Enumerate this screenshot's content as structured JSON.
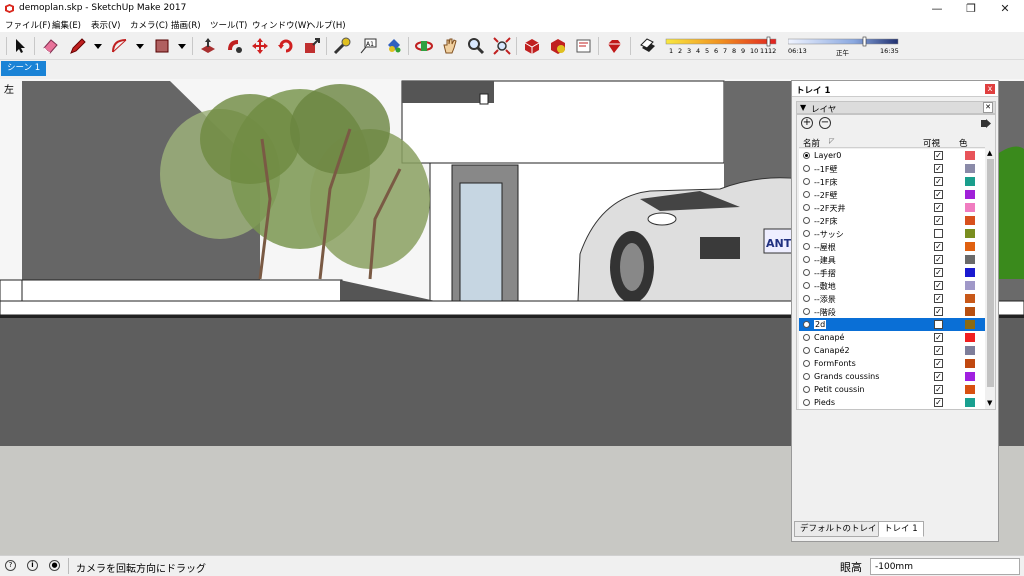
{
  "window": {
    "title": "demoplan.skp - SketchUp Make 2017"
  },
  "menu": [
    "ファイル(F)",
    "編集(E)",
    "表示(V)",
    "カメラ(C)",
    "描画(R)",
    "ツール(T)",
    "ウィンドウ(W)",
    "ヘルプ(H)"
  ],
  "toolbar": {
    "icons": [
      "select-icon",
      "eraser-icon",
      "pencil-icon",
      "arc-icon",
      "rectangle-icon",
      "push-pull-icon",
      "follow-me-icon",
      "move-icon",
      "rotate-icon",
      "scale-icon",
      "tape-measure-icon",
      "text-icon",
      "paint-bucket-icon",
      "orbit-icon",
      "pan-icon",
      "zoom-icon",
      "zoom-extents-icon",
      "3d-warehouse-icon",
      "extension-warehouse-icon",
      "layout-icon",
      "ruby-icon",
      "shadow-toggle-icon"
    ],
    "shadow": {
      "months": [
        "1",
        "2",
        "3",
        "4",
        "5",
        "6",
        "7",
        "8",
        "9",
        "10",
        "11",
        "12"
      ],
      "time_start": "06:13",
      "time_noon": "正午",
      "time_end": "16:35"
    }
  },
  "scene_tab": "シーン 1",
  "viewport": {
    "view_label": "左"
  },
  "tray": {
    "title": "トレイ 1",
    "close": "x",
    "section": "レイヤ",
    "columns": {
      "name": "名前",
      "visible": "可視",
      "color": "色"
    },
    "layers": [
      {
        "name": "Layer0",
        "active": true,
        "visible": true,
        "color": "#e8545a"
      },
      {
        "name": "--1F壁",
        "active": false,
        "visible": true,
        "color": "#8a8aa8"
      },
      {
        "name": "--1F床",
        "active": false,
        "visible": true,
        "color": "#1a9e8c"
      },
      {
        "name": "--2F壁",
        "active": false,
        "visible": true,
        "color": "#a020d8"
      },
      {
        "name": "--2F天井",
        "active": false,
        "visible": true,
        "color": "#f07cc0"
      },
      {
        "name": "--2F床",
        "active": false,
        "visible": true,
        "color": "#d8501c"
      },
      {
        "name": "--サッシ",
        "active": false,
        "visible": false,
        "color": "#7a8e20"
      },
      {
        "name": "--屋根",
        "active": false,
        "visible": true,
        "color": "#e06010"
      },
      {
        "name": "--建具",
        "active": false,
        "visible": true,
        "color": "#6a6a6a"
      },
      {
        "name": "--手摺",
        "active": false,
        "visible": true,
        "color": "#1a1ad0"
      },
      {
        "name": "--敷地",
        "active": false,
        "visible": true,
        "color": "#a098c8"
      },
      {
        "name": "--添景",
        "active": false,
        "visible": true,
        "color": "#c85818"
      },
      {
        "name": "--階段",
        "active": false,
        "visible": true,
        "color": "#b85010"
      },
      {
        "name": "2d",
        "active": false,
        "visible": false,
        "color": "#8a6a10",
        "selected": true
      },
      {
        "name": "Canapé",
        "active": false,
        "visible": true,
        "color": "#f02020"
      },
      {
        "name": "Canapé2",
        "active": false,
        "visible": true,
        "color": "#7e7e9a"
      },
      {
        "name": "FormFonts",
        "active": false,
        "visible": true,
        "color": "#c04810"
      },
      {
        "name": "Grands coussins",
        "active": false,
        "visible": true,
        "color": "#a020e0"
      },
      {
        "name": "Petit coussin",
        "active": false,
        "visible": true,
        "color": "#d85010"
      },
      {
        "name": "Pieds",
        "active": false,
        "visible": true,
        "color": "#1aa090"
      }
    ],
    "tabs": [
      "デフォルトのトレイ",
      "トレイ 1"
    ]
  },
  "status": {
    "message": "カメラを回転方向にドラッグ",
    "measure_label": "眼高",
    "measure_value": "-100mm"
  }
}
